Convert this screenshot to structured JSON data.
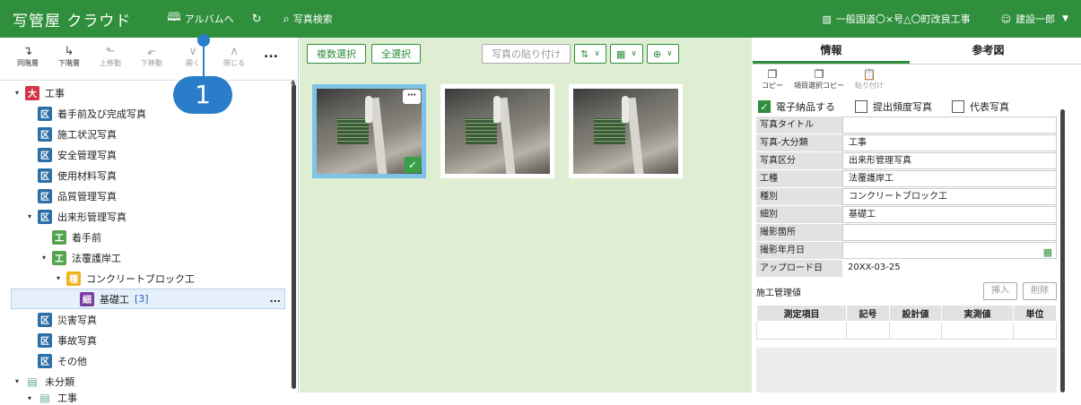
{
  "header": {
    "logo": "写管屋 クラウド",
    "album_label": "アルバムへ",
    "search_label": "写真検索",
    "project_name": "一般国道〇×号△〇町改良工事",
    "user_name": "建設一郎"
  },
  "left_toolbar": {
    "items": [
      {
        "label": "同階層",
        "icon": "⊏"
      },
      {
        "label": "下階層",
        "icon": "⊏"
      },
      {
        "label": "上移動",
        "icon": "⊏"
      },
      {
        "label": "下移動",
        "icon": "⊏"
      },
      {
        "label": "開く",
        "icon": "⌄"
      },
      {
        "label": "閉じる",
        "icon": "⌃"
      }
    ],
    "more": "..."
  },
  "tree": {
    "root": {
      "badge": "大",
      "label": "工事"
    },
    "items": [
      {
        "badge": "区",
        "label": "着手前及び完成写真"
      },
      {
        "badge": "区",
        "label": "施工状況写真"
      },
      {
        "badge": "区",
        "label": "安全管理写真"
      },
      {
        "badge": "区",
        "label": "使用材料写真"
      },
      {
        "badge": "区",
        "label": "品質管理写真"
      },
      {
        "badge": "区",
        "label": "出来形管理写真"
      },
      {
        "badge": "工",
        "label": "着手前"
      },
      {
        "badge": "工",
        "label": "法覆護岸工"
      },
      {
        "badge": "種",
        "label": "コンクリートブロック工"
      },
      {
        "badge": "細",
        "label": "基礎工",
        "count": "[3]",
        "more": "..."
      },
      {
        "badge": "区",
        "label": "災害写真"
      },
      {
        "badge": "区",
        "label": "事故写真"
      },
      {
        "badge": "区",
        "label": "その他"
      },
      {
        "badge": "",
        "label": "未分類"
      },
      {
        "badge": "",
        "label": "工事"
      }
    ]
  },
  "center_toolbar": {
    "multi_select": "複数選択",
    "select_all": "全選択",
    "paste": "写真の貼り付け"
  },
  "callout": "1",
  "right_panel": {
    "tabs": [
      "情報",
      "参考図"
    ],
    "actions": [
      {
        "label": "コピー"
      },
      {
        "label": "項目選択コピー"
      },
      {
        "label": "貼り付け"
      }
    ],
    "checks": [
      {
        "label": "電子納品する",
        "checked": true
      },
      {
        "label": "提出頻度写真",
        "checked": false
      },
      {
        "label": "代表写真",
        "checked": false
      }
    ],
    "fields": [
      {
        "label": "写真タイトル",
        "value": ""
      },
      {
        "label": "写真-大分類",
        "value": "工事"
      },
      {
        "label": "写真区分",
        "value": "出来形管理写真"
      },
      {
        "label": "工種",
        "value": "法覆護岸工"
      },
      {
        "label": "種別",
        "value": "コンクリートブロック工"
      },
      {
        "label": "細別",
        "value": "基礎工"
      },
      {
        "label": "撮影箇所",
        "value": ""
      },
      {
        "label": "撮影年月日",
        "value": ""
      },
      {
        "label": "アップロード日",
        "value": "20XX-03-25"
      }
    ],
    "construction_label": "施工管理値",
    "insert_label": "挿入",
    "delete_label": "削除",
    "table_headers": [
      "測定項目",
      "記号",
      "設計値",
      "実測値",
      "単位"
    ]
  },
  "colors": {
    "brand": "#2f8f3c",
    "callout": "#2a7ec9",
    "canvas": "#dfeed2"
  }
}
